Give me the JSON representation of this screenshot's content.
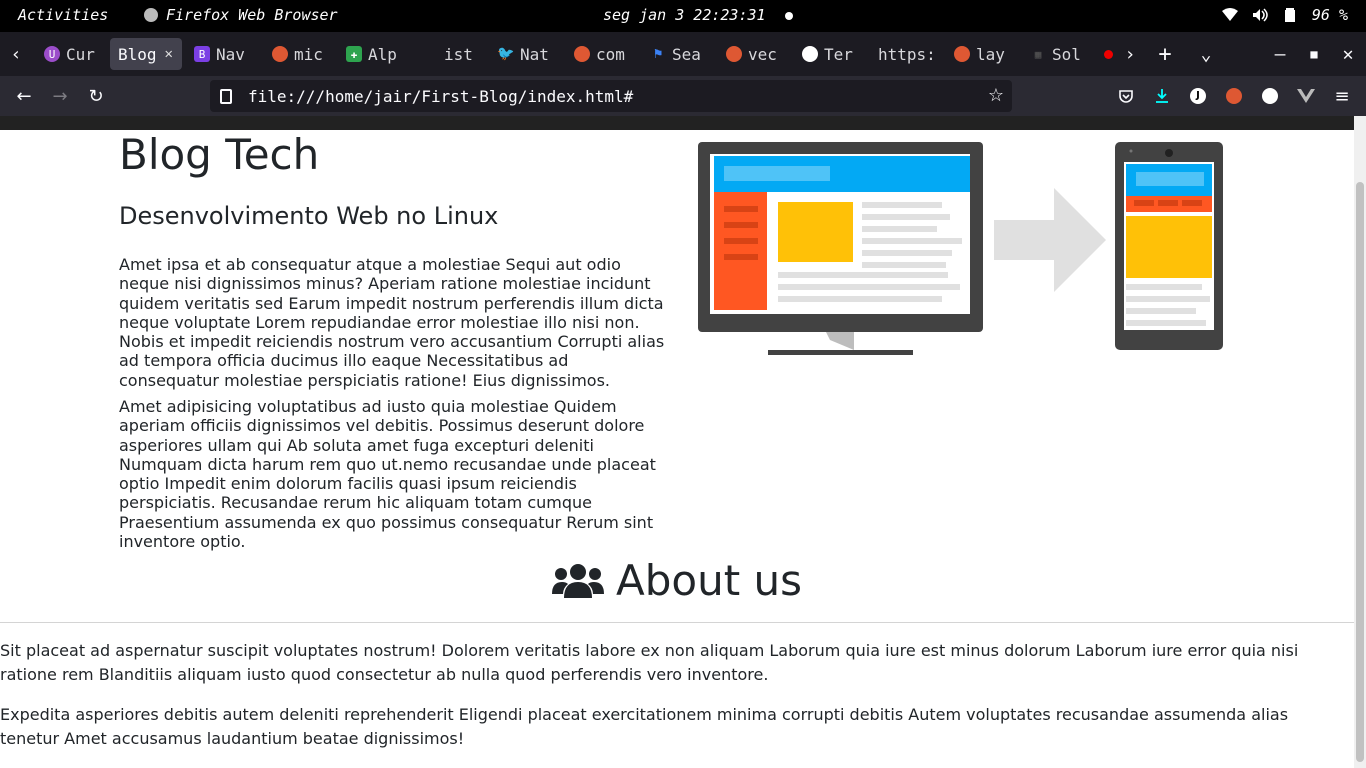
{
  "topbar": {
    "activities": "Activities",
    "app_name": "Firefox Web Browser",
    "clock": "seg jan 3  22:23:31",
    "battery": "96 %"
  },
  "tabs": [
    {
      "label": "Cur",
      "fav_color": "#9b4dca",
      "fav_glyph": "U"
    },
    {
      "label": "Blog",
      "active": true
    },
    {
      "label": "Nav",
      "fav_color": "#7b3fe4",
      "fav_glyph": "B"
    },
    {
      "label": "mic",
      "fav_color": "#de5833",
      "fav_glyph": "●"
    },
    {
      "label": "Alp",
      "fav_color": "#2ea44f",
      "fav_glyph": "✚"
    },
    {
      "label": "ist"
    },
    {
      "label": "Nat",
      "fav_color": "#1d9bf0",
      "fav_glyph": "🐦"
    },
    {
      "label": "com",
      "fav_color": "#de5833",
      "fav_glyph": "●"
    },
    {
      "label": "Sea",
      "fav_color": "#3b82f6",
      "fav_glyph": "⚑"
    },
    {
      "label": "vec",
      "fav_color": "#de5833",
      "fav_glyph": "●"
    },
    {
      "label": "Ter",
      "fav_color": "#ffffff",
      "fav_glyph": "◐"
    },
    {
      "label": "https:"
    },
    {
      "label": "lay",
      "fav_color": "#de5833",
      "fav_glyph": "●"
    },
    {
      "label": "Sol",
      "fav_color": "#333333",
      "fav_glyph": "▦"
    }
  ],
  "navbar": {
    "url": "file:///home/jair/First-Blog/index.html#"
  },
  "page": {
    "title": "Blog Tech",
    "subtitle": "Desenvolvimento Web no Linux",
    "paragraph1": "Amet ipsa et ab consequatur atque a molestiae Sequi aut odio neque nisi dignissimos minus? Aperiam ratione molestiae incidunt quidem veritatis sed Earum impedit nostrum perferendis illum dicta neque voluptate Lorem repudiandae error molestiae illo nisi non. Nobis et impedit reiciendis nostrum vero accusantium Corrupti alias ad tempora officia ducimus illo eaque Necessitatibus ad consequatur molestiae perspiciatis ratione! Eius dignissimos.",
    "paragraph2": "Amet adipisicing voluptatibus ad iusto quia molestiae Quidem aperiam officiis dignissimos vel debitis. Possimus deserunt dolore asperiores ullam qui Ab soluta amet fuga excepturi deleniti Numquam dicta harum rem quo ut.nemo recusandae unde placeat optio Impedit enim dolorum facilis quasi ipsum reiciendis perspiciatis. Recusandae rerum hic aliquam totam cumque Praesentium assumenda ex quo possimus consequatur Rerum sint inventore optio.",
    "about_title": "About us",
    "about_p1": "Sit placeat ad aspernatur suscipit voluptates nostrum! Dolorem veritatis labore ex non aliquam Laborum quia iure est minus dolorum Laborum iure error quia nisi ratione rem Blanditiis aliquam iusto quod consectetur ab nulla quod perferendis vero inventore.",
    "about_p2": "Expedita asperiores debitis autem deleniti reprehenderit Eligendi placeat exercitationem minima corrupti debitis Autem voluptates recusandae assumenda alias tenetur Amet accusamus laudantium beatae dignissimos!"
  },
  "colors": {
    "topbar_bg": "#000000",
    "tabbar_bg": "#1c1b22",
    "navbar_bg": "#2b2a33",
    "illustration_blue": "#03a9f4",
    "illustration_orange": "#ff5722",
    "illustration_yellow": "#ffc107"
  }
}
